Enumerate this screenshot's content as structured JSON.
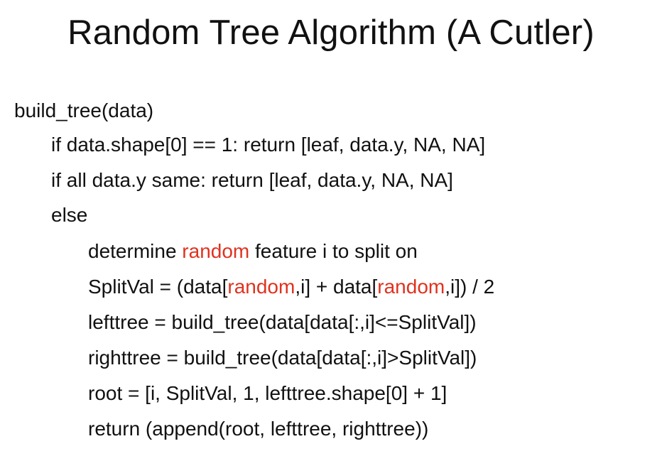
{
  "slide": {
    "title": "Random Tree Algorithm (A Cutler)",
    "highlight_color": "#e0321f",
    "code_lines": [
      {
        "text": "build_tree(data)"
      },
      {
        "text": "if data.shape[0] == 1: return [leaf, data.y, NA, NA]"
      },
      {
        "text": "if all data.y same: return [leaf, data.y, NA, NA]"
      },
      {
        "text": "else"
      },
      {
        "pre": "determine ",
        "hl": "random",
        "post": " feature i to split on"
      },
      {
        "a": "SplitVal = (data[",
        "hl1": "random",
        "b": ",i] + data[",
        "hl2": "random",
        "c": ",i]) / 2"
      },
      {
        "text": "lefttree = build_tree(data[data[:,i]<=SplitVal])"
      },
      {
        "text": "righttree = build_tree(data[data[:,i]>SplitVal])"
      },
      {
        "text": "root = [i, SplitVal, 1, lefttree.shape[0] + 1]"
      },
      {
        "text": "return (append(root, lefttree, righttree))"
      }
    ]
  }
}
